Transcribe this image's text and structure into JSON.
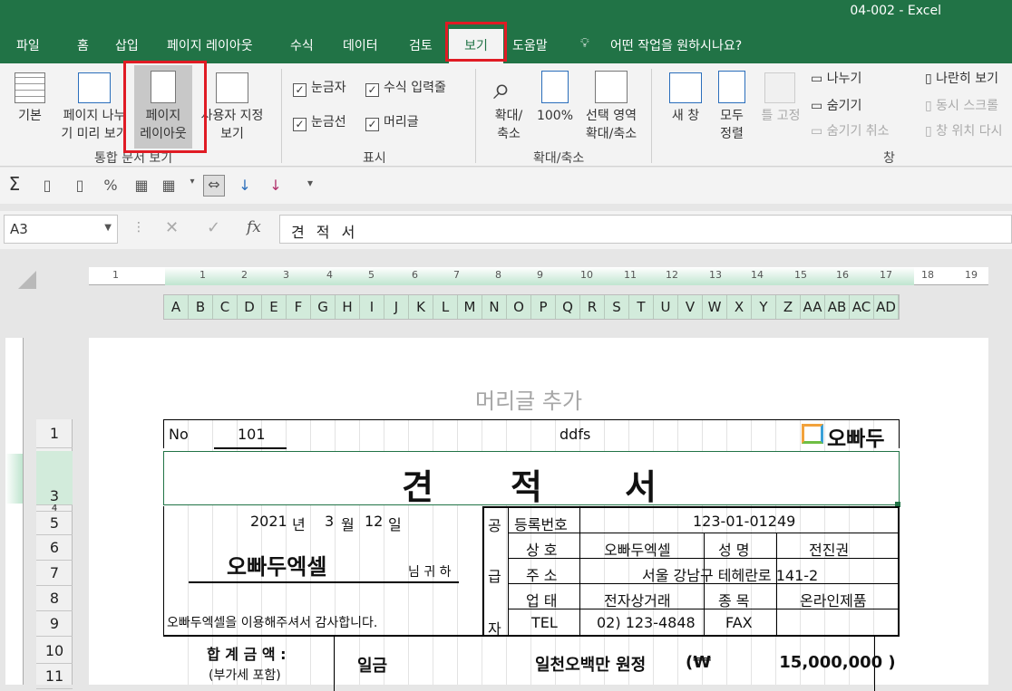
{
  "window": {
    "title": "04-002  -  Excel"
  },
  "tabs": [
    "파일",
    "홈",
    "삽입",
    "페이지 레이아웃",
    "수식",
    "데이터",
    "검토",
    "보기",
    "도움말"
  ],
  "tell_me": "어떤 작업을 원하시나요?",
  "ribbon": {
    "views": {
      "normal": "기본",
      "page_break": [
        "페이지 나누",
        "기 미리 보기"
      ],
      "page_layout": [
        "페이지",
        "레이아웃"
      ],
      "custom": [
        "사용자 지정",
        "보기"
      ],
      "group": "통합 문서 보기"
    },
    "show": {
      "ruler": "눈금자",
      "gridlines": "눈금선",
      "formula_bar": "수식 입력줄",
      "headings": "머리글",
      "group": "표시"
    },
    "zoom": {
      "zoom": [
        "확대/",
        "축소"
      ],
      "zoom100": "100%",
      "zoom_sel": [
        "선택 영역",
        "확대/축소"
      ],
      "group": "확대/축소"
    },
    "window": {
      "new": "새 창",
      "arrange": [
        "모두",
        "정렬"
      ],
      "freeze": "틀 고정",
      "split": "나누기",
      "hide": "숨기기",
      "unhide": "숨기기 취소",
      "side": "나란히 보기",
      "sync": "동시 스크롤",
      "reset": "창 위치 다시",
      "group": "창"
    }
  },
  "namebox": "A3",
  "formula": "견 적 서",
  "ruler_numbers": [
    "1",
    "1",
    "2",
    "3",
    "4",
    "5",
    "6",
    "7",
    "8",
    "9",
    "10",
    "11",
    "12",
    "13",
    "14",
    "15",
    "16",
    "17",
    "18",
    "19"
  ],
  "columns": [
    "A",
    "B",
    "C",
    "D",
    "E",
    "F",
    "G",
    "H",
    "I",
    "J",
    "K",
    "L",
    "M",
    "N",
    "O",
    "P",
    "Q",
    "R",
    "S",
    "T",
    "U",
    "V",
    "W",
    "X",
    "Y",
    "Z",
    "AA",
    "AB",
    "AC",
    "AD"
  ],
  "rows": [
    "1",
    "3",
    "4",
    "5",
    "6",
    "7",
    "8",
    "9",
    "10",
    "11"
  ],
  "header_placeholder": "머리글 추가",
  "doc": {
    "no_label": "No",
    "no_value": "101",
    "ddfs": "ddfs",
    "logo_text": "오빠두",
    "title": [
      "견",
      "적",
      "서"
    ],
    "date": {
      "year": "2021",
      "y": "년",
      "month": "3",
      "m": "월",
      "day": "12",
      "d": "일"
    },
    "client": "오빠두엑셀",
    "honorific": "님 귀 하",
    "thanks": "오빠두엑셀을 이용해주셔서 감사합니다.",
    "supplier_label": [
      "공",
      "급",
      "자"
    ],
    "reg_label": "등록번호",
    "reg_value": "123-01-01249",
    "name_label": "상 호",
    "name_value": "오빠두엑셀",
    "ceo_label": "성 명",
    "ceo_value": "전진권",
    "addr_label": "주 소",
    "addr_value": "서울 강남구 테헤란로 141-2",
    "biz_label": "업 태",
    "biz_value": "전자상거래",
    "item_label": "종 목",
    "item_value": "온라인제품",
    "tel_label": "TEL",
    "tel_value": "02) 123-4848",
    "fax_label": "FAX",
    "total_label": "합 계 금 액 :",
    "total_sub": "(부가세 포함)",
    "total_prefix": "일금",
    "total_words": "일천오백만 원정",
    "total_num": "(₩            15,000,000 )"
  }
}
